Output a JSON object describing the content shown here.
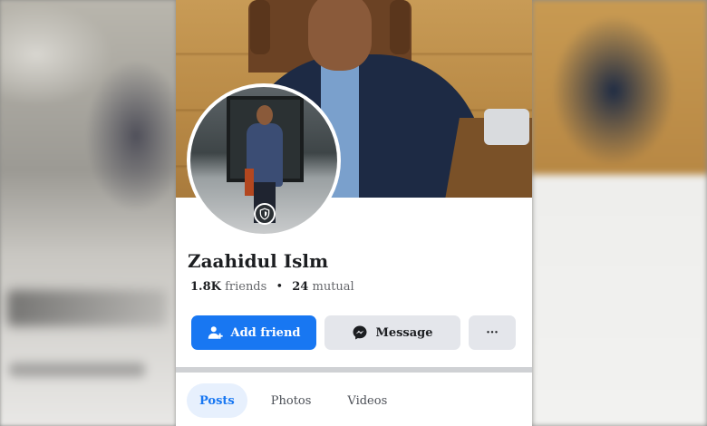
{
  "profile": {
    "name": "Zaahidul Islm",
    "friends_count": "1.8K",
    "friends_label": "friends",
    "mutual_count": "24",
    "mutual_label": "mutual",
    "avatar_badge_icon": "shield-icon"
  },
  "actions": {
    "add_friend": "Add friend",
    "message": "Message",
    "more": "···"
  },
  "tabs": [
    {
      "label": "Posts",
      "active": true
    },
    {
      "label": "Photos",
      "active": false
    },
    {
      "label": "Videos",
      "active": false
    }
  ],
  "colors": {
    "accent": "#1877f2",
    "button_gray": "#e4e6eb",
    "active_tab_bg": "#e7f0fd"
  },
  "icons": {
    "add_friend": "add-person-icon",
    "message": "messenger-icon",
    "more": "more-dots-icon"
  }
}
